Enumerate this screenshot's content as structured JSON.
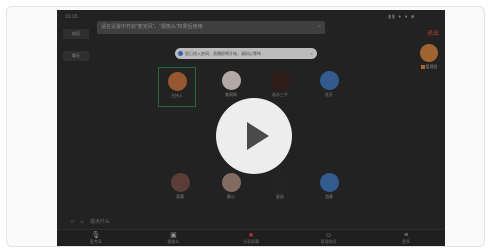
{
  "status_bar": {
    "time": "16:03",
    "right_icons": "▮▮ ● ● ■"
  },
  "top_right_link": "退出",
  "left_panel": {
    "items": [
      "成员",
      "聊天"
    ]
  },
  "notice": {
    "text": "请在设置中开启“麦克风”、“摄像头”权限后使用",
    "close": "×"
  },
  "pill": {
    "text": "您已进入房间，直播即将开始，请耐心等待",
    "close": "×"
  },
  "seats_top": [
    {
      "name": "主持人",
      "color": "#b86b3c"
    },
    {
      "name": "美姆姆",
      "color": "#d9cfc9"
    },
    {
      "name": "若水三千",
      "color": "#3b2420"
    },
    {
      "name": "花开",
      "color": "#3f6fae"
    }
  ],
  "seats_bottom": [
    {
      "name": "東葉",
      "color": "#6d4b43"
    },
    {
      "name": "静心",
      "color": "#9f8478"
    },
    {
      "name": "星辰",
      "color": "#2c2c2c"
    },
    {
      "name": "游客",
      "color": "#3f6fae"
    }
  ],
  "right_user": {
    "label": "管理员"
  },
  "bottom_left": {
    "items": [
      "□",
      "☺",
      "说点什么"
    ]
  },
  "toolbar": [
    {
      "icon": "🎙",
      "label": "麦克风",
      "red": false
    },
    {
      "icon": "▣",
      "label": "摄像头",
      "red": false
    },
    {
      "icon": "■",
      "label": "分享屏幕",
      "red": true
    },
    {
      "icon": "☺",
      "label": "管理成员",
      "red": false
    },
    {
      "icon": "≡",
      "label": "更多",
      "red": false
    }
  ]
}
